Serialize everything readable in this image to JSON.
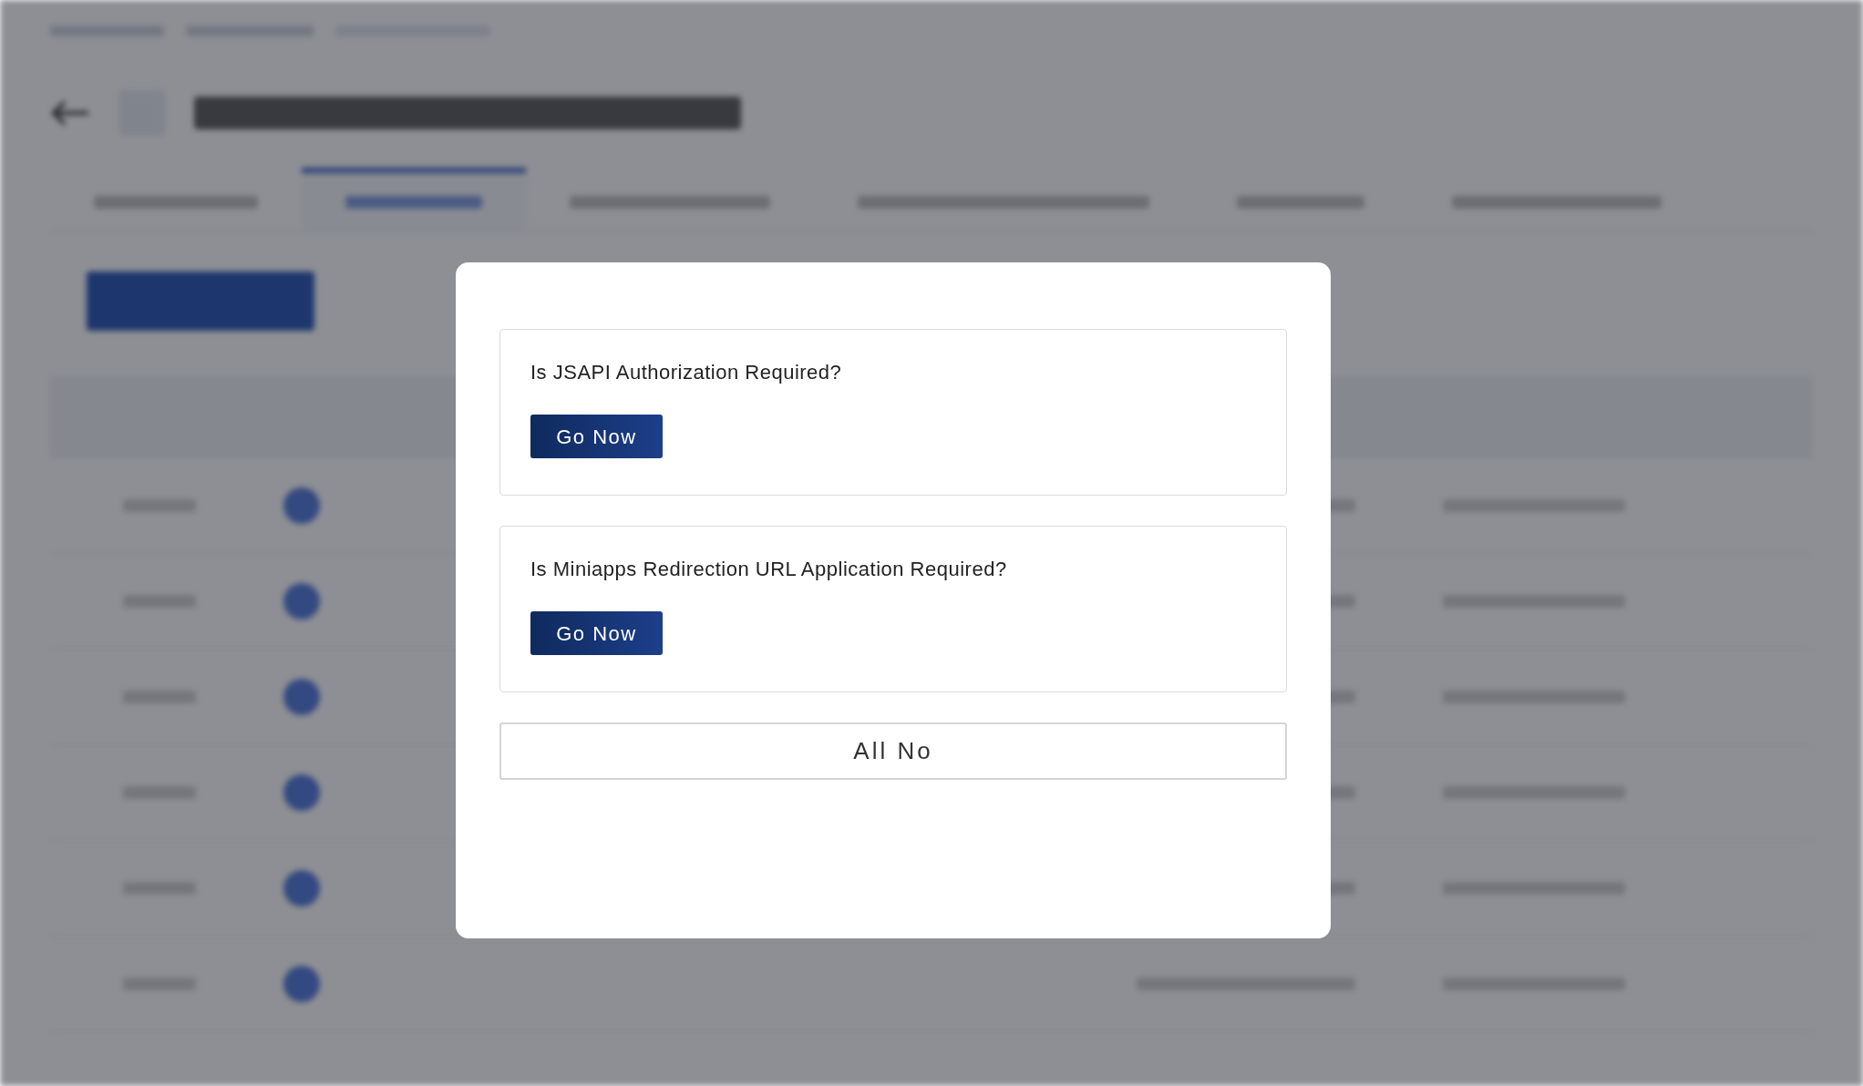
{
  "dialog": {
    "questions": [
      {
        "text": "Is JSAPI Authorization Required?",
        "button": "Go Now"
      },
      {
        "text": "Is Miniapps Redirection URL Application Required?",
        "button": "Go Now"
      }
    ],
    "dismiss_button": "All No"
  }
}
